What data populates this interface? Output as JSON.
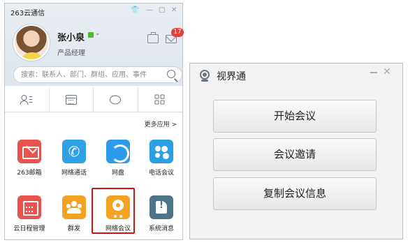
{
  "left_window": {
    "title": "263云通信",
    "user": {
      "name": "张小泉",
      "role": "产品经理",
      "status_color": "#42c02b"
    },
    "mail_badge": "17",
    "search": {
      "placeholder": "搜索：联系人、部门、群组、应用、事件"
    },
    "tabs": [
      {
        "icon": "contacts-icon"
      },
      {
        "icon": "calendar-icon"
      },
      {
        "icon": "chat-icon"
      },
      {
        "icon": "apps-grid-icon",
        "selected": true
      }
    ],
    "more_apps_label": "更多应用 >",
    "apps": [
      {
        "name": "263邮箱",
        "color": "#e8524f",
        "icon": "mail-icon"
      },
      {
        "name": "网络通话",
        "color": "#2fa2e6",
        "icon": "phone-icon"
      },
      {
        "name": "网盘",
        "color": "#2d9bec",
        "icon": "cloud-disk-icon"
      },
      {
        "name": "电话会议",
        "color": "#2a9fe1",
        "icon": "conference-call-icon"
      },
      {
        "name": "云日程管理",
        "color": "#e8524f",
        "icon": "calendar-icon"
      },
      {
        "name": "群发",
        "color": "#f4a224",
        "icon": "group-send-icon"
      },
      {
        "name": "网络会议",
        "color": "#f4a224",
        "icon": "webcam-icon",
        "selected": true
      },
      {
        "name": "系统消息",
        "color": "#4d7489",
        "icon": "system-message-icon"
      }
    ]
  },
  "right_window": {
    "title": "视界通",
    "buttons": {
      "start": "开始会议",
      "invite": "会议邀请",
      "copy": "复制会议信息"
    }
  },
  "colors": {
    "highlight_frame": "#c9161b",
    "badge": "#e0413a"
  }
}
